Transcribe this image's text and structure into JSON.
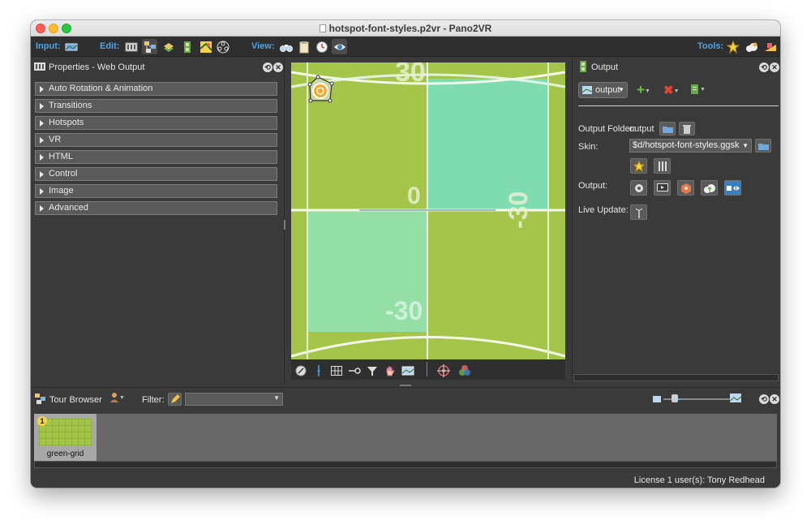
{
  "window": {
    "title": "hotspot-font-styles.p2vr - Pano2VR"
  },
  "toolbar": {
    "input_label": "Input:",
    "edit_label": "Edit:",
    "view_label": "View:",
    "tools_label": "Tools:",
    "input_icons": [
      "panorama-input-icon"
    ],
    "edit_icons": [
      "viewing-parameters-icon",
      "tour-map-icon",
      "patch-icon",
      "output-icon",
      "floor-plan-icon",
      "animation-icon"
    ],
    "view_icons": [
      "binoculars-icon",
      "clipboard-icon",
      "viewer-icon",
      "eye-icon"
    ],
    "tools_icons": [
      "skin-editor-icon",
      "cloud-icon",
      "convert-icon"
    ]
  },
  "properties": {
    "title": "Properties - Web Output",
    "sections": [
      "Auto Rotation & Animation",
      "Transitions",
      "Hotspots",
      "VR",
      "HTML",
      "Control",
      "Image",
      "Advanced"
    ]
  },
  "viewer": {
    "grid_labels": [
      "30",
      "0",
      "-30",
      "-30"
    ],
    "bottom_tools": [
      "compass-icon",
      "crosshair-line-icon",
      "grid-icon",
      "key-icon",
      "filter-icon",
      "hand-icon",
      "flat-image-icon",
      "target-icon",
      "color-circles-icon"
    ]
  },
  "output": {
    "title": "Output",
    "selected_output": "output",
    "folder_label": "Output Folder:",
    "folder_value": "output",
    "skin_label": "Skin:",
    "skin_value": "$d/hotspot-font-styles.ggsk",
    "output_label": "Output:",
    "live_update_label": "Live Update:"
  },
  "tour_browser": {
    "title": "Tour Browser",
    "filter_label": "Filter:",
    "filter_value": "",
    "nodes": [
      {
        "number": "1",
        "label": "green-grid"
      }
    ]
  },
  "status": {
    "license": "License 1 user(s): Tony Redhead"
  },
  "colors": {
    "accent": "#4fa3e6",
    "viewer_green": "#a5c54a",
    "viewer_teal": "#7fdcb0",
    "panel_bg": "#3a3a3a"
  }
}
